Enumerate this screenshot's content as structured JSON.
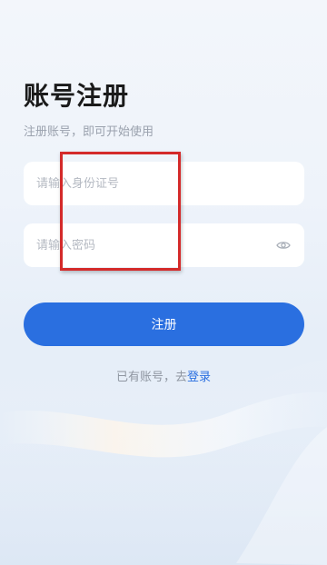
{
  "page": {
    "title": "账号注册",
    "subtitle": "注册账号，即可开始使用"
  },
  "form": {
    "id_field": {
      "placeholder": "请输入身份证号",
      "value": ""
    },
    "password_field": {
      "placeholder": "请输入密码",
      "value": "",
      "toggle_icon": "eye-icon"
    },
    "submit_label": "注册"
  },
  "footer": {
    "prompt": "已有账号，去",
    "login_link": "登录"
  },
  "colors": {
    "accent": "#2a6fe0",
    "annotation": "#d42a2a",
    "title": "#1a1a1a",
    "muted": "#9aa1ad"
  }
}
